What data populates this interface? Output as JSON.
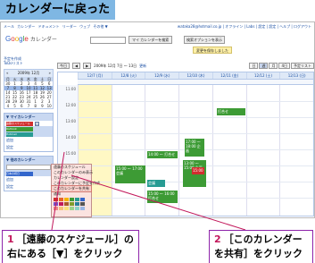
{
  "banner": {
    "title": "カレンダーに戻った"
  },
  "topnav": {
    "items": [
      "メール",
      "カレンダー",
      "ドキュメント",
      "リーダー",
      "ウェブ",
      "その他 ▼"
    ]
  },
  "account": {
    "text": "wataka28@hotmail.co.jp | オフライン | Labs | 設定 | 設定 | ヘルプ | ログアウト"
  },
  "logo": {
    "letters": [
      "G",
      "o",
      "o",
      "g",
      "l",
      "e"
    ],
    "suffix": "カレンダー"
  },
  "search": {
    "button_label": "マイ カレンダーを検索",
    "options_label": "検索オプションを表示",
    "notice": "変更を保存しました"
  },
  "sidebar": {
    "create_event": "予定を作成",
    "todo": "ToDoリスト",
    "mini": {
      "month": "2009年 12月",
      "prev": "«",
      "next": "»",
      "dow": [
        "月",
        "火",
        "水",
        "木",
        "金",
        "土",
        "日"
      ],
      "days": [
        "30",
        "1",
        "2",
        "3",
        "4",
        "5",
        "6",
        "7",
        "8",
        "9",
        "10",
        "11",
        "12",
        "13",
        "14",
        "15",
        "16",
        "17",
        "18",
        "19",
        "20",
        "21",
        "22",
        "23",
        "24",
        "25",
        "26",
        "27",
        "28",
        "29",
        "30",
        "31",
        "1",
        "2",
        "3",
        "4",
        "5",
        "6",
        "7",
        "8",
        "9",
        "10"
      ]
    },
    "my_calendars": {
      "header": "▼ マイカレンダー",
      "items": [
        {
          "label": "遠藤のスケジュール",
          "color": "#d22e2e"
        },
        {
          "label": "Outlook",
          "color": "#3d9b35"
        },
        {
          "label": "Hotmail",
          "color": "#279b93"
        }
      ],
      "add": "追加",
      "settings": "設定"
    },
    "other_calendars": {
      "header": "▼ 他のカレンダー",
      "search_placeholder": "友達のカレンダーを追加",
      "item": "日本の祝日",
      "add": "追加",
      "settings": "設定"
    }
  },
  "toolbar": {
    "today": "今日",
    "prev": "◀",
    "next": "▶",
    "range": "2009年 12月 7日 ～ 13日",
    "refresh": "更新",
    "views": [
      "日",
      "週",
      "月",
      "4日",
      "予定リスト"
    ]
  },
  "week": {
    "days": [
      "12/7 (月)",
      "12/8 (火)",
      "12/9 (水)",
      "12/10 (木)",
      "12/11 (金)",
      "12/12 (土)",
      "12/13 (日)"
    ],
    "hours": [
      "11:00",
      "12:00",
      "13:00",
      "14:00",
      "15:00",
      "16:00",
      "17:00",
      "18:00"
    ],
    "events": [
      {
        "label": "打合せ",
        "color": "green"
      },
      {
        "label": "14:00 ～ 打合せ",
        "color": "green"
      },
      {
        "label": "15:00 ～ 17:00 会議",
        "color": "green"
      },
      {
        "label": "17:00 ～ 18:00 企画",
        "color": "green"
      },
      {
        "label": "15:00 ～ 16:00 打合せ",
        "color": "green"
      },
      {
        "label": "13:00 ～ 15:00 企画",
        "color": "green"
      },
      {
        "label": "15:00",
        "color": "red"
      },
      {
        "label": "会議",
        "color": "teal"
      }
    ]
  },
  "menu": {
    "items": [
      "遠藤のスケジュール",
      "このカレンダーのみ表示",
      "カレンダー設定",
      "このカレンダーに予定を作成",
      "このカレンダーを共有",
      "通知"
    ],
    "swatches": [
      "#d22e2e",
      "#e6662b",
      "#f4b400",
      "#3d9b35",
      "#279b93",
      "#3366cc",
      "#7b4fc8",
      "#c2185b",
      "#a85b2a",
      "#7f9b2a",
      "#2a7f9b",
      "#555555",
      "#e88",
      "#f4c27a",
      "#f7e27a",
      "#9bd28a",
      "#8ad2c8",
      "#9ab7e6"
    ]
  },
  "callouts": [
    {
      "num": "1",
      "lines": [
        "［遠藤のスケジュール］の",
        "右にある［▼］をクリック"
      ]
    },
    {
      "num": "2",
      "lines": [
        "［このカレンダー",
        "を共有］をクリック"
      ]
    }
  ]
}
